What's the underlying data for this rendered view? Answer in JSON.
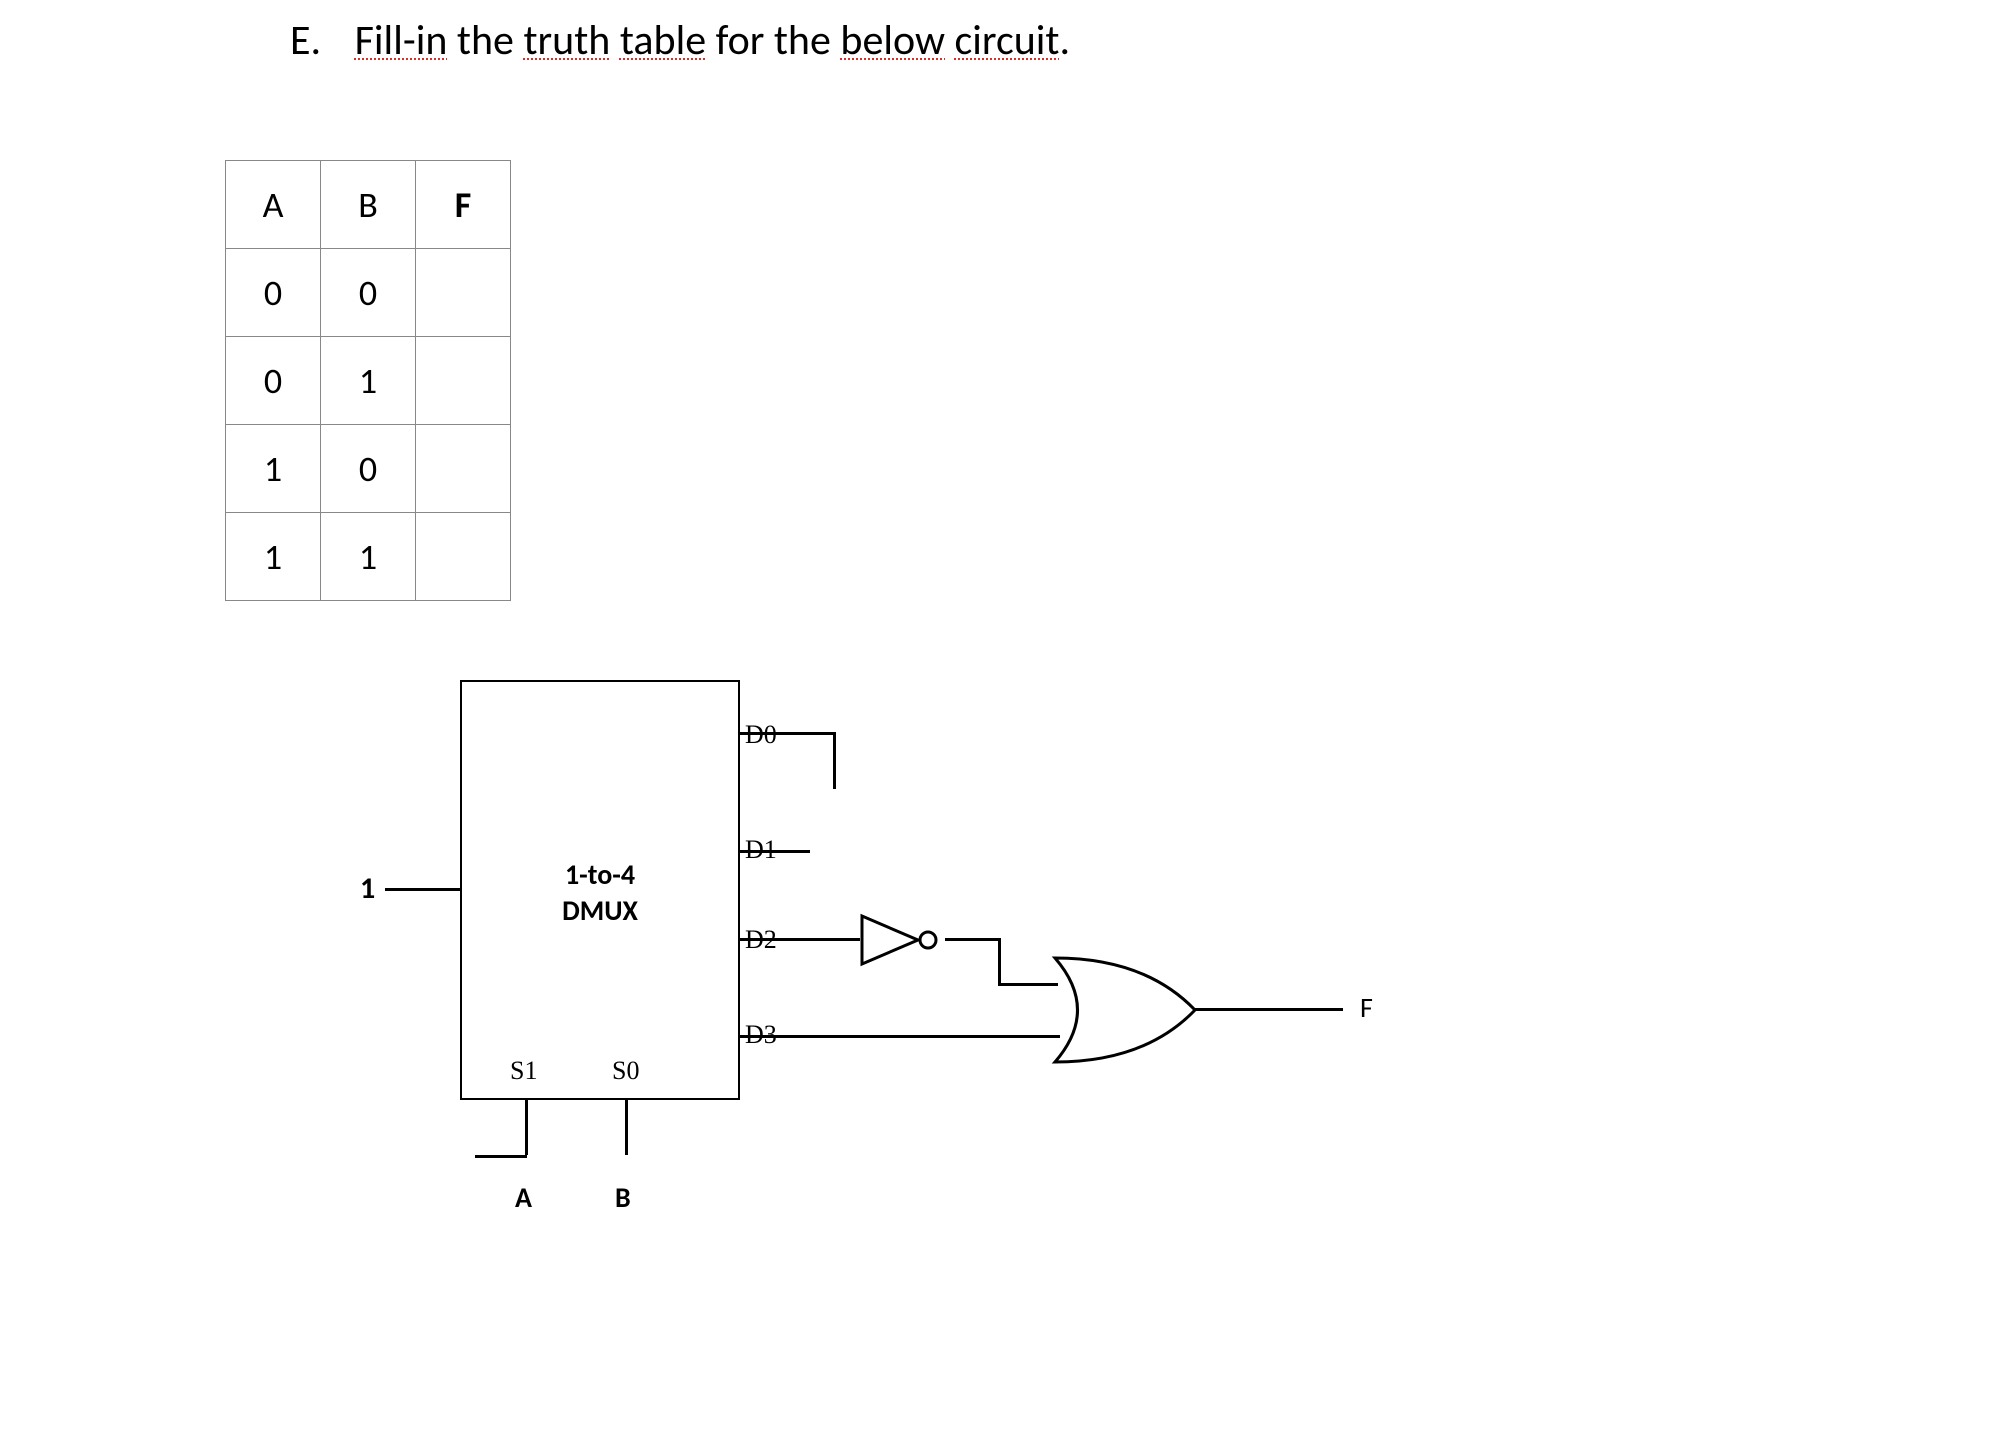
{
  "question": {
    "list_letter": "E.",
    "text_p1": "Fill-in",
    "text_p2": " the ",
    "text_p3": "truth",
    "text_p4": " ",
    "text_p5": "table",
    "text_p6": " for the ",
    "text_p7": "below",
    "text_p8": " ",
    "text_p9": "circuit",
    "text_p10": "."
  },
  "table": {
    "headers": {
      "a": "A",
      "b": "B",
      "f": "F"
    },
    "rows": [
      {
        "a": "0",
        "b": "0",
        "f": ""
      },
      {
        "a": "0",
        "b": "1",
        "f": ""
      },
      {
        "a": "1",
        "b": "0",
        "f": ""
      },
      {
        "a": "1",
        "b": "1",
        "f": ""
      }
    ]
  },
  "circuit": {
    "input_value": "1",
    "dmux_line1": "1-to-4",
    "dmux_line2": "DMUX",
    "s1": "S1",
    "s0": "S0",
    "d0": "D0",
    "d1": "D1",
    "d2": "D2",
    "d3": "D3",
    "sel_a": "A",
    "sel_b": "B",
    "output": "F"
  }
}
